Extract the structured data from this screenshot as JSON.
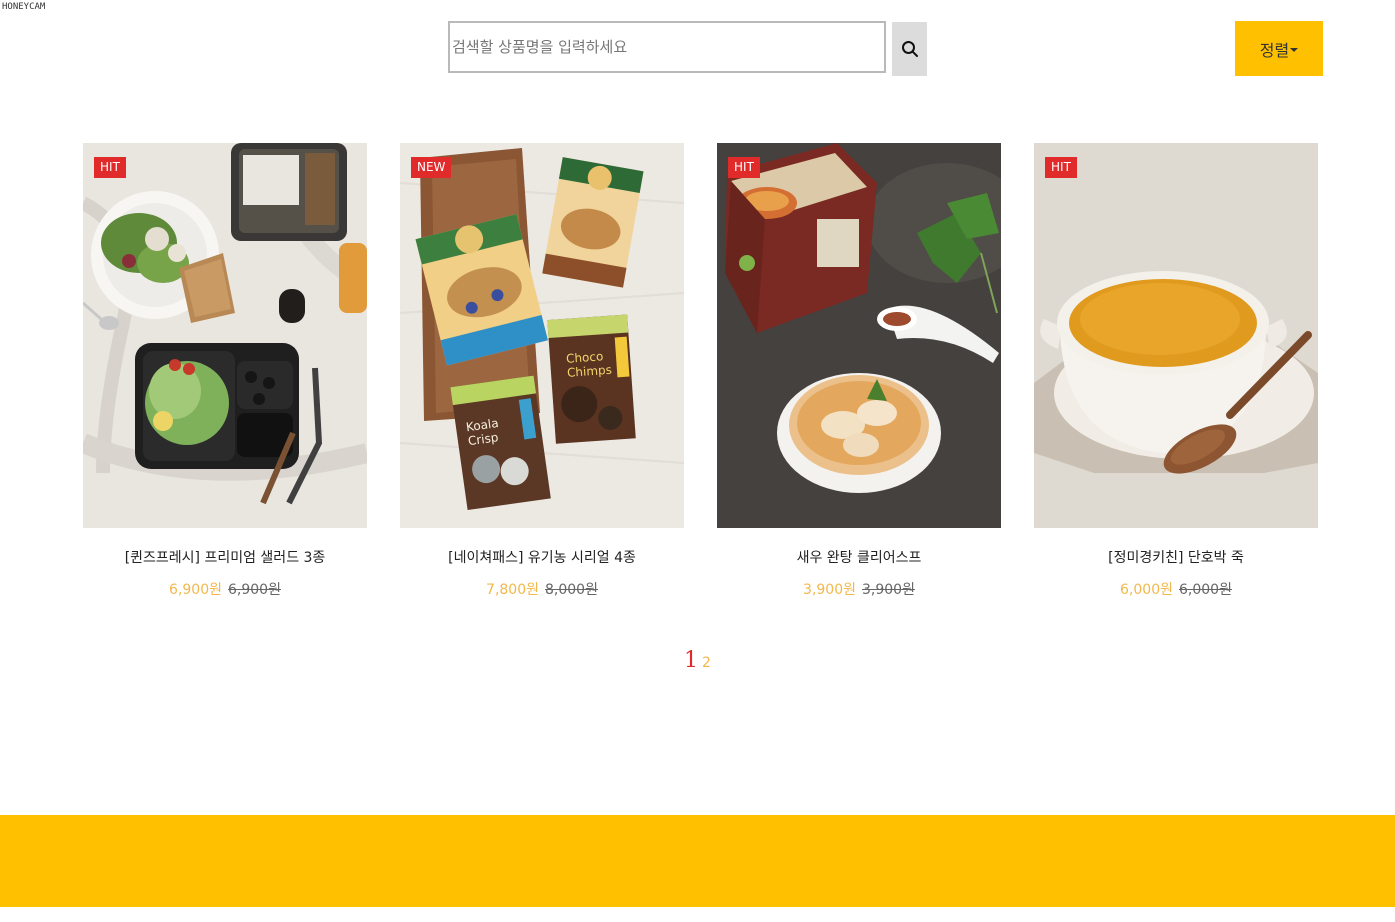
{
  "watermark": "HONEYCAM",
  "search": {
    "placeholder": "검색할 상품명을 입력하세요",
    "value": "",
    "button_icon": "search-icon"
  },
  "sort": {
    "label": "정렬",
    "icon": "caret-down-icon",
    "color": "#ffc000"
  },
  "products": [
    {
      "badge": "HIT",
      "name": "[퀸즈프레시] 프리미엄 샐러드 3종",
      "sale_price": "6,900원",
      "original_price": "6,900원",
      "image": "salad-image"
    },
    {
      "badge": "NEW",
      "name": "[네이쳐패스] 유기농 시리얼 4종",
      "sale_price": "7,800원",
      "original_price": "8,000원",
      "image": "cereal-image"
    },
    {
      "badge": "HIT",
      "name": "새우 완탕 클리어스프",
      "sale_price": "3,900원",
      "original_price": "3,900원",
      "image": "wonton-soup-image"
    },
    {
      "badge": "HIT",
      "name": "[정미경키친] 단호박 죽",
      "sale_price": "6,000원",
      "original_price": "6,000원",
      "image": "pumpkin-porridge-image"
    }
  ],
  "pagination": {
    "pages": [
      "1",
      "2"
    ],
    "current": "1"
  },
  "colors": {
    "accent": "#ffc000",
    "badge": "#e12a2a",
    "price": "#f2b84b",
    "current_page": "#e12a2a"
  }
}
